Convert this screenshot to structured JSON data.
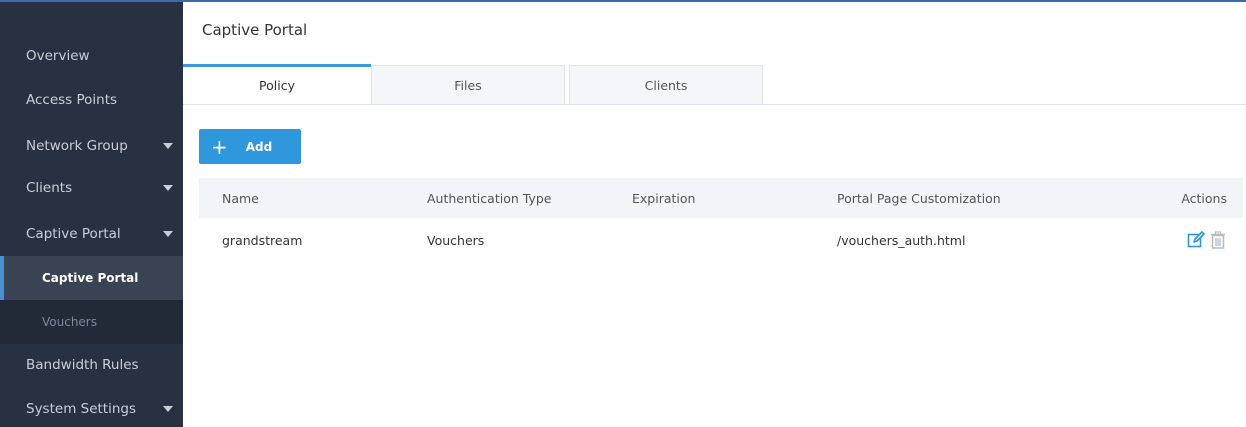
{
  "sidebar": {
    "items": [
      {
        "label": "Overview"
      },
      {
        "label": "Access Points"
      },
      {
        "label": "Network Group"
      },
      {
        "label": "Clients"
      },
      {
        "label": "Captive Portal"
      },
      {
        "label": "Captive Portal"
      },
      {
        "label": "Vouchers"
      },
      {
        "label": "Bandwidth Rules"
      },
      {
        "label": "System Settings"
      }
    ]
  },
  "main": {
    "title": "Captive Portal",
    "tabs": [
      {
        "label": "Policy"
      },
      {
        "label": "Files"
      },
      {
        "label": "Clients"
      }
    ],
    "add_label": "Add",
    "table": {
      "headers": {
        "name": "Name",
        "auth": "Authentication Type",
        "expiration": "Expiration",
        "portal": "Portal Page Customization",
        "actions": "Actions"
      },
      "rows": [
        {
          "name": "grandstream",
          "auth": "Vouchers",
          "expiration": "",
          "portal": "/vouchers_auth.html"
        }
      ]
    }
  },
  "colors": {
    "sidebar_bg": "#283142",
    "accent": "#2f97dc",
    "edit_icon": "#2f97dc",
    "delete_icon": "#b5bcc6"
  },
  "icons": {
    "add": "plus-icon",
    "edit": "edit-icon",
    "delete": "trash-icon",
    "submenu": "caret-down-icon"
  }
}
